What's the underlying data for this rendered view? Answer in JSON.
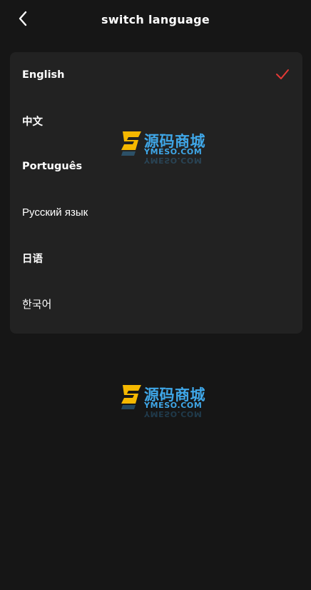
{
  "header": {
    "title": "switch language"
  },
  "languages": {
    "items": [
      {
        "label": "English",
        "selected": true
      },
      {
        "label": "中文",
        "selected": false
      },
      {
        "label": "Português",
        "selected": false
      },
      {
        "label": "Русский язык",
        "selected": false
      },
      {
        "label": "日语",
        "selected": false
      },
      {
        "label": "한국어",
        "selected": false
      }
    ]
  },
  "watermark": {
    "text": "源码商城",
    "subtext": "YMESO.COM"
  },
  "colors": {
    "background": "#161616",
    "card": "#222222",
    "check_accent": "#e53935",
    "watermark_blue": "#3fa7e8",
    "watermark_yellow": "#f5b800"
  },
  "icons": {
    "back": "chevron-left-icon",
    "selected": "checkmark-icon"
  }
}
